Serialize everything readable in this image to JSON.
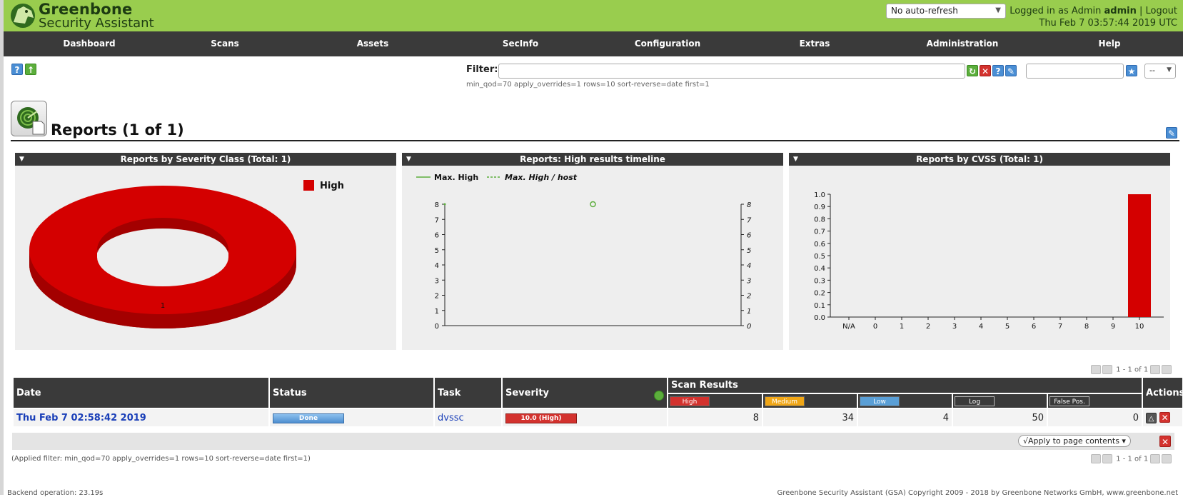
{
  "header": {
    "brand_line1": "Greenbone",
    "brand_line2": "Security Assistant",
    "refresh_select": "No auto-refresh",
    "logged_in_prefix": "Logged in as",
    "role": "Admin",
    "username": "admin",
    "logout": "Logout",
    "datetime": "Thu Feb 7 03:57:44 2019 UTC"
  },
  "nav": [
    "Dashboard",
    "Scans",
    "Assets",
    "SecInfo",
    "Configuration",
    "Extras",
    "Administration",
    "Help"
  ],
  "filter": {
    "label": "Filter:",
    "value": "",
    "hint": "min_qod=70 apply_overrides=1 rows=10 sort-reverse=date first=1",
    "save_name": "",
    "select_value": "--"
  },
  "page": {
    "title": "Reports (1 of 1)"
  },
  "panels": {
    "severity_class": {
      "title": "Reports by Severity Class (Total: 1)",
      "legend": "High",
      "slice_label": "1"
    },
    "timeline": {
      "title": "Reports: High results timeline",
      "legend1": "Max. High",
      "legend2": "Max. High / host"
    },
    "cvss": {
      "title": "Reports by CVSS (Total: 1)"
    }
  },
  "chart_data": [
    {
      "type": "pie",
      "title": "Reports by Severity Class (Total: 1)",
      "categories": [
        "High"
      ],
      "values": [
        1
      ],
      "colors": [
        "#d40000"
      ],
      "legend": "top-right"
    },
    {
      "type": "line",
      "title": "Reports: High results timeline",
      "series": [
        {
          "name": "Max. High",
          "x": [
            0
          ],
          "values": [
            8
          ]
        },
        {
          "name": "Max. High / host",
          "x": [
            0.5
          ],
          "values": [
            8
          ]
        }
      ],
      "ylim": [
        0,
        8
      ],
      "yticks": [
        0,
        1,
        2,
        3,
        4,
        5,
        6,
        7,
        8
      ]
    },
    {
      "type": "bar",
      "title": "Reports by CVSS (Total: 1)",
      "categories": [
        "N/A",
        "0",
        "1",
        "2",
        "3",
        "4",
        "5",
        "6",
        "7",
        "8",
        "9",
        "10"
      ],
      "values": [
        0,
        0,
        0,
        0,
        0,
        0,
        0,
        0,
        0,
        0,
        0,
        1.0
      ],
      "ylim": [
        0,
        1.0
      ],
      "yticks": [
        "0.0",
        "0.1",
        "0.2",
        "0.3",
        "0.4",
        "0.5",
        "0.6",
        "0.7",
        "0.8",
        "0.9",
        "1.0"
      ],
      "bar_color": "#d40000"
    }
  ],
  "table": {
    "pager": "1 - 1 of 1",
    "headers": {
      "date": "Date",
      "status": "Status",
      "task": "Task",
      "severity": "Severity",
      "scan_results": "Scan Results",
      "actions": "Actions"
    },
    "levels": [
      "High",
      "Medium",
      "Low",
      "Log",
      "False Pos."
    ],
    "rows": [
      {
        "date": "Thu Feb 7 02:58:42 2019",
        "status": "Done",
        "task": "dvssc",
        "severity": "10.0 (High)",
        "high": "8",
        "medium": "34",
        "low": "4",
        "log": "50",
        "false_pos": "0"
      }
    ],
    "apply_select": "√Apply to page contents",
    "applied_filter": "(Applied filter: min_qod=70 apply_overrides=1 rows=10 sort-reverse=date first=1)"
  },
  "footer": {
    "backend": "Backend operation: 23.19s",
    "copyright": "Greenbone Security Assistant (GSA) Copyright 2009 - 2018 by Greenbone Networks GmbH, www.greenbone.net"
  },
  "colors": {
    "header_green": "#99cd4e",
    "dark": "#3a3a3a",
    "high_red": "#d40000"
  }
}
